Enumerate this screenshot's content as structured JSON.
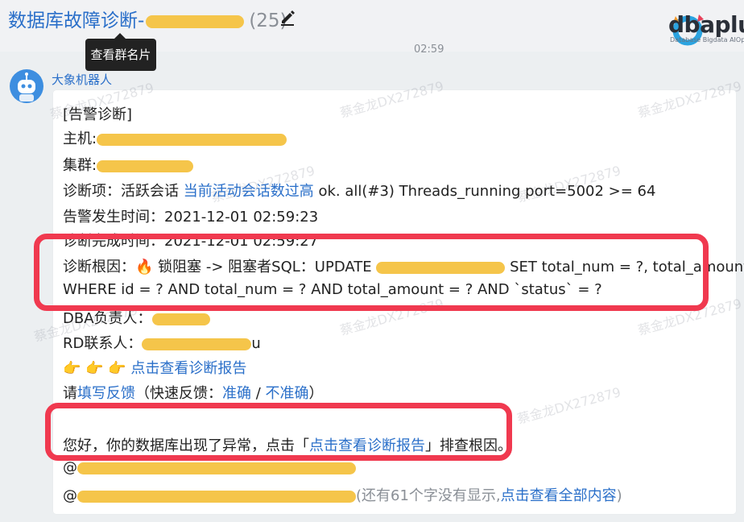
{
  "header": {
    "title": "数据库故障诊断-",
    "member_count": "(25)",
    "tooltip": "查看群名片",
    "timestamp": "02:59"
  },
  "logo": {
    "brand": "dbaplus",
    "tagline": "Database  Bigdata  AIOps"
  },
  "message": {
    "sender": "大象机器人",
    "watermark": "蔡金龙DX272879",
    "lines": {
      "tag": "[告警诊断]",
      "host_label": "主机:",
      "cluster_label": "集群:",
      "item_label": "诊断项：活跃会话 ",
      "item_link": "当前活动会话数过高",
      "item_rest": " ok. all(#3) Threads_running port=5002 >= 64",
      "alert_time": "告警发生时间：2021-12-01 02:59:23",
      "finish_time": "诊断完成时间：2021-12-01 02:59:27",
      "root_label": "诊断根因：",
      "root_text_1": " 锁阻塞 -> 阻塞者SQL：UPDATE ",
      "root_text_2": " SET total_num = ?, total_amount = ?",
      "root_text_3": "WHERE id = ? AND total_num = ? AND total_amount = ? AND `status` = ?",
      "dba_label": "DBA负责人：",
      "rd_label": "RD联系人：",
      "rd_tail": "u",
      "report_link": "点击查看诊断报告",
      "feedback_pre": "请",
      "feedback_link": "填写反馈",
      "feedback_mid": "（快速反馈：",
      "feedback_accurate": "准确",
      "feedback_sep": " / ",
      "feedback_inaccurate": "不准确",
      "feedback_end": "）",
      "notice_pre": "您好，你的数据库出现了异常，点击「",
      "notice_link": "点击查看诊断报告",
      "notice_post": "」排查根因。",
      "at_1": "@",
      "at_2": "@",
      "hidden_note": "(还有61个字没有显示,",
      "show_all_link": "点击查看全部内容",
      "show_all_end": ")"
    }
  },
  "colors": {
    "link": "#2a6fc9",
    "highlight_border": "#f0394f",
    "redaction": "#f5c54a"
  }
}
